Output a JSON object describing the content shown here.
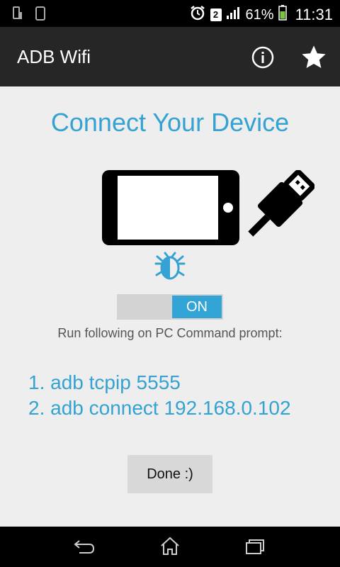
{
  "status": {
    "notification_count": "2",
    "battery": "61%",
    "time": "11:31",
    "icons": [
      "phone-notification-icon",
      "device-icon",
      "alarm-icon",
      "signal-icon",
      "battery-icon"
    ]
  },
  "app_bar": {
    "title": "ADB Wifi",
    "actions": [
      "info-icon",
      "star-icon"
    ]
  },
  "main": {
    "headline": "Connect Your Device",
    "toggle_label": "ON",
    "instruction": "Run following on PC Command prompt:",
    "commands": [
      "1. adb tcpip 5555",
      "2. adb connect 192.168.0.102"
    ],
    "done_label": "Done :)"
  },
  "nav": [
    "back-icon",
    "home-icon",
    "recent-apps-icon"
  ],
  "colors": {
    "accent": "#34a2d2",
    "toggle_on": "#33a4d6"
  }
}
